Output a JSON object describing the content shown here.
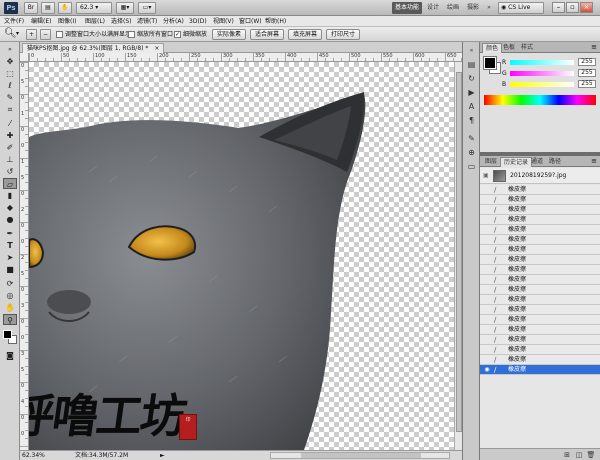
{
  "app": {
    "logo": "Ps",
    "zoom_value": "62.3",
    "cs_live": "CS Live"
  },
  "workspaces": [
    "基本功能",
    "设计",
    "绘画",
    "摄影"
  ],
  "workspace_more": "»",
  "menu": [
    "文件(F)",
    "编辑(E)",
    "图像(I)",
    "图层(L)",
    "选择(S)",
    "滤镜(T)",
    "分析(A)",
    "3D(D)",
    "视图(V)",
    "窗口(W)",
    "帮助(H)"
  ],
  "options": {
    "resize_windows": "调整窗口大小以满屏显示",
    "zoom_all": "缩放所有窗口",
    "scrubby_zoom": "细微缩放",
    "actual_pixels": "实际像素",
    "fit_screen": "适合屏幕",
    "fill_screen": "填充屏幕",
    "print_size": "打印尺寸"
  },
  "document": {
    "tab": "猫咪PS抠图.jpg @ 62.3%(图层 1, RGB/8) *",
    "tab_close": "×"
  },
  "ruler_top": [
    "0",
    "50",
    "100",
    "150",
    "200",
    "250",
    "300",
    "350",
    "400",
    "450",
    "500",
    "550",
    "600",
    "650"
  ],
  "ruler_left": [
    "0",
    "5",
    "0",
    "1",
    "0",
    "0",
    "1",
    "5",
    "0",
    "2",
    "0",
    "0",
    "2",
    "5",
    "0",
    "3",
    "0",
    "0",
    "3",
    "5",
    "0",
    "4",
    "0",
    "0"
  ],
  "status": {
    "zoom": "62.34%",
    "doc": "文档:34.3M/57.2M",
    "arrow": "►"
  },
  "color_panel": {
    "tabs": [
      "颜色",
      "色板",
      "样式"
    ],
    "sliders": [
      {
        "letter": "R",
        "value": "255",
        "color": "#e02020"
      },
      {
        "letter": "G",
        "value": "255",
        "color": "#20b020"
      },
      {
        "letter": "B",
        "value": "255",
        "color": "#2040e0"
      }
    ]
  },
  "history_panel": {
    "tabs": [
      "图层",
      "历史记录",
      "通道",
      "路径"
    ],
    "snapshot": "20120819259?.jpg",
    "step_label": "橡皮擦",
    "step_count": 19
  },
  "watermark": {
    "text": "呼噜工坊",
    "seal": "印"
  }
}
